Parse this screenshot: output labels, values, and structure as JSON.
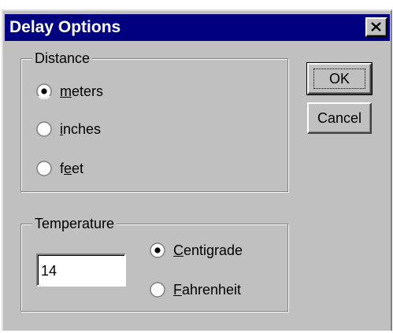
{
  "window": {
    "title": "Delay Options",
    "close_label": "Close"
  },
  "distance": {
    "legend": "Distance",
    "options": [
      {
        "label": "meters",
        "accel": "m",
        "rest": "eters",
        "selected": true
      },
      {
        "label": "inches",
        "accel": "i",
        "rest": "nches",
        "selected": false
      },
      {
        "label": "feet",
        "pre": "f",
        "accel": "e",
        "rest": "et",
        "selected": false
      }
    ]
  },
  "temperature": {
    "legend": "Temperature",
    "value": "14",
    "options": [
      {
        "label": "Centigrade",
        "accel": "C",
        "rest": "entigrade",
        "selected": true
      },
      {
        "label": "Fahrenheit",
        "accel": "F",
        "rest": "ahrenheit",
        "selected": false
      }
    ]
  },
  "buttons": {
    "ok": "OK",
    "cancel": "Cancel"
  },
  "colors": {
    "titlebar": "#000080",
    "face": "#c0c0c0"
  }
}
